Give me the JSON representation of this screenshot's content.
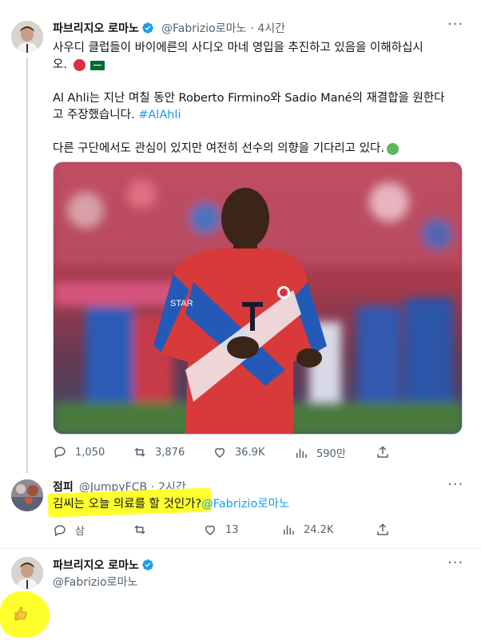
{
  "tweet1": {
    "author": "파브리지오 로마노",
    "handle": "@Fabrizio로마노",
    "time": "· 4시간",
    "line1": "사우디 클럽들이 바이에른의 사디오 마네 영입을 추진하고 있음을 이해하십시",
    "line2": "오.",
    "para2_line1": "Al Ahli는 지난 며칠 동안 Roberto Firmino와 Sadio Mané의 재결합을 원한다",
    "para2_line2_text": "고 주장했습니다. ",
    "hashtag": "#AlAhli",
    "para3": "다른 구단에서도 관심이 있지만 여전히 선수의 의향을 기다리고 있다.",
    "jersey_text": "STAR",
    "stats": {
      "replies": "1,050",
      "retweets": "3,876",
      "likes": "36.9K",
      "views": "590만"
    }
  },
  "tweet2": {
    "author": "점피",
    "handle": "@JumpyFCB",
    "time": "· 2시간",
    "text": "김씨는 오늘 의료를 할 것인가?",
    "mention": "@Fabrizio로마노",
    "stats": {
      "replies": "삼",
      "likes": "13",
      "views": "24.2K"
    }
  },
  "tweet3": {
    "author": "파브리지오 로마노",
    "handle": "@Fabrizio로마노"
  },
  "colors": {
    "accent": "#1d9bf0",
    "highlight": "#ffff2e",
    "green_circle": "#5cb85c",
    "red_circle": "#dd2e44"
  }
}
